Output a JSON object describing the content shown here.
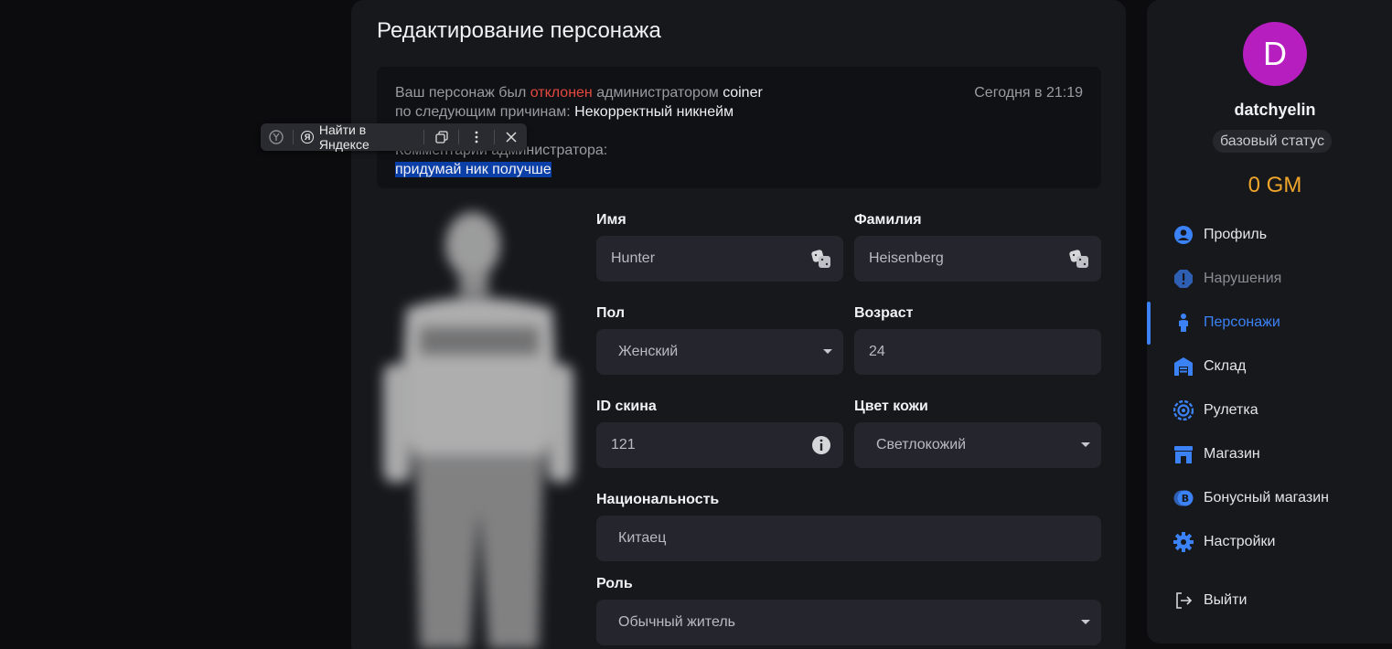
{
  "page": {
    "title": "Редактирование персонажа"
  },
  "notice": {
    "p1": "Ваш персонаж был ",
    "rejected": "отклонен",
    "p2": " администратором ",
    "admin": "coiner",
    "p3": "по следующим причинам: ",
    "reason": "Некорректный никнейм",
    "comment_label": "Комментарий администратора:",
    "comment": "придумай ник получше",
    "time": "Сегодня в 21:19"
  },
  "yandex_bar": {
    "find_label": "Найти в Яндексе"
  },
  "form": {
    "first_name_label": "Имя",
    "first_name_value": "Hunter",
    "last_name_label": "Фамилия",
    "last_name_value": "Heisenberg",
    "gender_label": "Пол",
    "gender_value": "Женский",
    "age_label": "Возраст",
    "age_value": "24",
    "skin_id_label": "ID скина",
    "skin_id_value": "121",
    "skin_color_label": "Цвет кожи",
    "skin_color_value": "Светлокожий",
    "nationality_label": "Национальность",
    "nationality_value": "Китаец",
    "role_label": "Роль",
    "role_value": "Обычный житель"
  },
  "sidebar": {
    "avatar_letter": "D",
    "username": "datchyelin",
    "status": "базовый статус",
    "balance": "0 GM",
    "items": [
      {
        "label": "Профиль",
        "icon": "user-icon"
      },
      {
        "label": "Нарушения",
        "icon": "alert-icon"
      },
      {
        "label": "Персонажи",
        "icon": "person-icon"
      },
      {
        "label": "Склад",
        "icon": "warehouse-icon"
      },
      {
        "label": "Рулетка",
        "icon": "roulette-icon"
      },
      {
        "label": "Магазин",
        "icon": "store-icon"
      },
      {
        "label": "Бонусный магазин",
        "icon": "bonus-icon"
      },
      {
        "label": "Настройки",
        "icon": "gear-icon"
      }
    ],
    "logout": "Выйти"
  },
  "colors": {
    "accent": "#3b82f6",
    "reject": "#e5483f",
    "balance": "#f0a52b",
    "avatar": "#b61ec0"
  }
}
